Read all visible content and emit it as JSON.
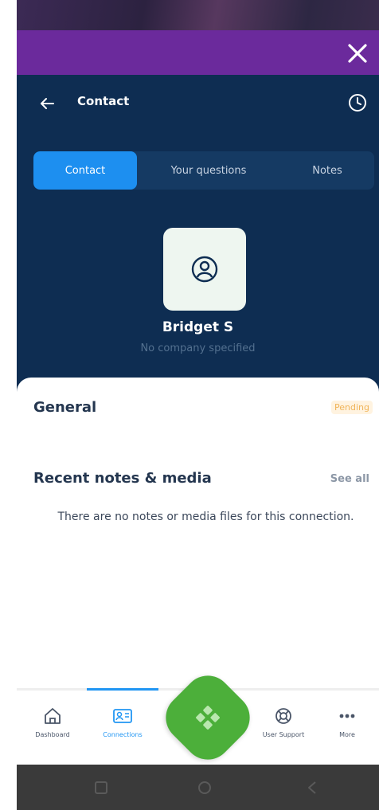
{
  "header": {
    "title": "Contact"
  },
  "tabs": [
    {
      "label": "Contact",
      "active": true
    },
    {
      "label": "Your questions",
      "active": false
    },
    {
      "label": "Notes",
      "active": false
    }
  ],
  "profile": {
    "name": "Bridget S",
    "company": "No company specified"
  },
  "general": {
    "title": "General",
    "status": "Pending"
  },
  "recent": {
    "title": "Recent notes & media",
    "see_all": "See all",
    "empty_message": "There are no notes or media files for this connection."
  },
  "bottom_nav": [
    {
      "label": "Dashboard",
      "icon": "home-icon",
      "active": false
    },
    {
      "label": "Connections",
      "icon": "contact-card-icon",
      "active": true
    },
    {
      "label": "User Support",
      "icon": "lifebuoy-icon",
      "active": false
    },
    {
      "label": "More",
      "icon": "more-dots-icon",
      "active": false
    }
  ],
  "colors": {
    "modal_bar": "#6b2a9c",
    "header_bg": "#0e2d52",
    "active_tab": "#1d8ff0",
    "fab": "#4caf3a",
    "pending": "#f0b45a"
  }
}
